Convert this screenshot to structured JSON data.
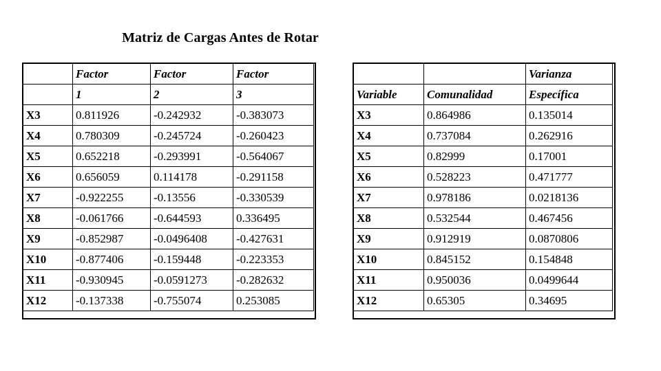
{
  "title": "Matriz de Cargas Antes de Rotar",
  "loadings_table": {
    "name": "factor-loadings-table",
    "header_line1": [
      "",
      "Factor",
      "Factor",
      "Factor"
    ],
    "header_line2": [
      "",
      "1",
      "2",
      "3"
    ],
    "rows": [
      {
        "variable": "X3",
        "factor1": "0.811926",
        "factor2": "-0.242932",
        "factor3": "-0.383073"
      },
      {
        "variable": "X4",
        "factor1": "0.780309",
        "factor2": "-0.245724",
        "factor3": "-0.260423"
      },
      {
        "variable": "X5",
        "factor1": "0.652218",
        "factor2": "-0.293991",
        "factor3": "-0.564067"
      },
      {
        "variable": "X6",
        "factor1": "0.656059",
        "factor2": "0.114178",
        "factor3": "-0.291158"
      },
      {
        "variable": "X7",
        "factor1": "-0.922255",
        "factor2": "-0.13556",
        "factor3": "-0.330539"
      },
      {
        "variable": "X8",
        "factor1": "-0.061766",
        "factor2": "-0.644593",
        "factor3": "0.336495"
      },
      {
        "variable": "X9",
        "factor1": "-0.852987",
        "factor2": "-0.0496408",
        "factor3": "-0.427631"
      },
      {
        "variable": "X10",
        "factor1": "-0.877406",
        "factor2": "-0.159448",
        "factor3": "-0.223353"
      },
      {
        "variable": "X11",
        "factor1": "-0.930945",
        "factor2": "-0.0591273",
        "factor3": "-0.282632"
      },
      {
        "variable": "X12",
        "factor1": "-0.137338",
        "factor2": "-0.755074",
        "factor3": "0.253085"
      }
    ]
  },
  "communalities_table": {
    "name": "communalities-table",
    "header_line1": [
      "",
      "",
      "Varianza"
    ],
    "header_line2": [
      "Variable",
      "Comunalidad",
      "Específica"
    ],
    "rows": [
      {
        "variable": "X3",
        "comunalidad": "0.864986",
        "varianza_especifica": "0.135014"
      },
      {
        "variable": "X4",
        "comunalidad": "0.737084",
        "varianza_especifica": "0.262916"
      },
      {
        "variable": "X5",
        "comunalidad": "0.82999",
        "varianza_especifica": "0.17001"
      },
      {
        "variable": "X6",
        "comunalidad": "0.528223",
        "varianza_especifica": "0.471777"
      },
      {
        "variable": "X7",
        "comunalidad": "0.978186",
        "varianza_especifica": "0.0218136"
      },
      {
        "variable": "X8",
        "comunalidad": "0.532544",
        "varianza_especifica": "0.467456"
      },
      {
        "variable": "X9",
        "comunalidad": "0.912919",
        "varianza_especifica": "0.0870806"
      },
      {
        "variable": "X10",
        "comunalidad": "0.845152",
        "varianza_especifica": "0.154848"
      },
      {
        "variable": "X11",
        "comunalidad": "0.950036",
        "varianza_especifica": "0.0499644"
      },
      {
        "variable": "X12",
        "comunalidad": "0.65305",
        "varianza_especifica": "0.34695"
      }
    ]
  },
  "colors": {
    "background": "#ffffff",
    "text": "#000000",
    "border": "#000000"
  }
}
